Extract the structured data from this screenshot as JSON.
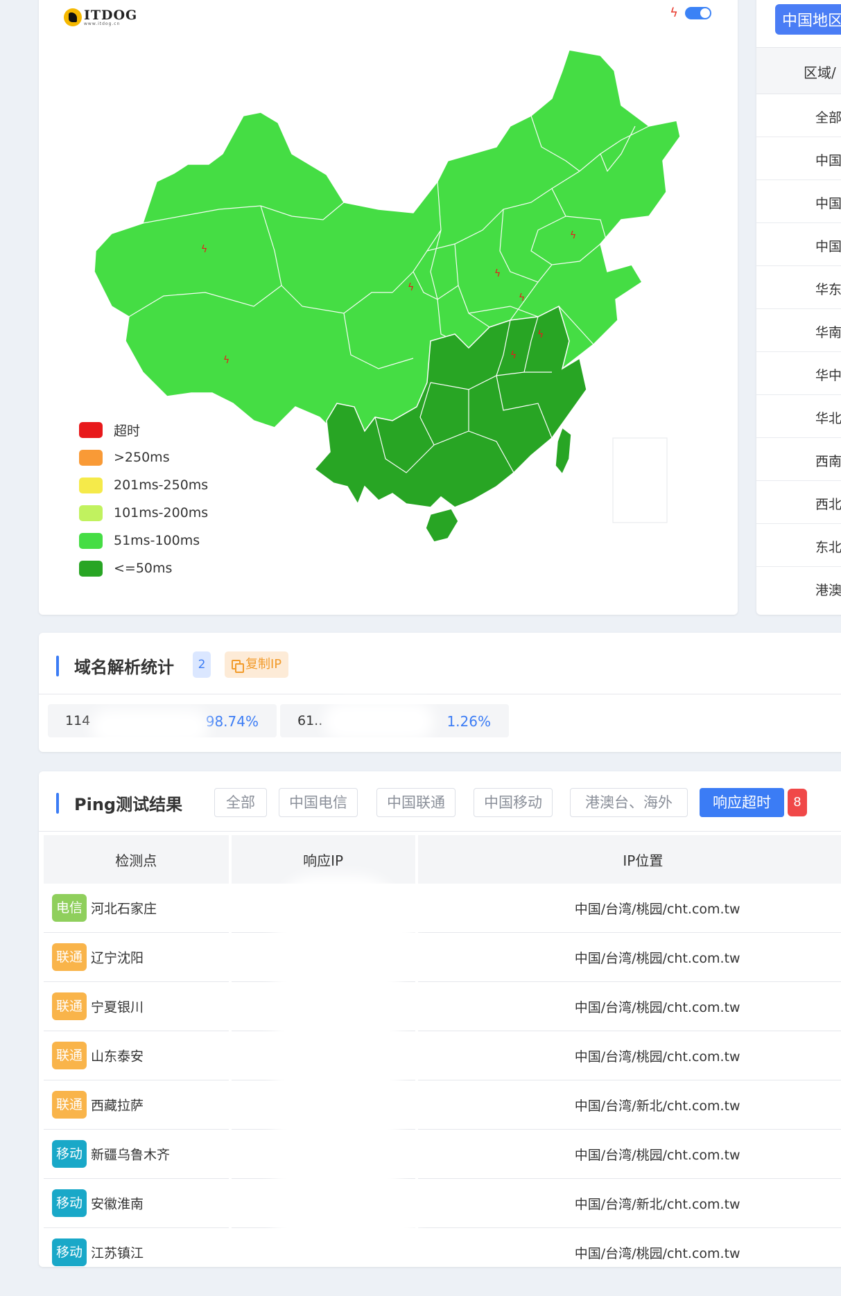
{
  "map": {
    "logo_text": "ITDOG",
    "logo_sub": "www.itdog.cn",
    "legend": [
      {
        "label": "超时",
        "color": "#e8191b"
      },
      {
        "label": ">250ms",
        "color": "#f99a36"
      },
      {
        "label": "201ms-250ms",
        "color": "#f5ea4a"
      },
      {
        "label": "101ms-200ms",
        "color": "#c1f25f"
      },
      {
        "label": "51ms-100ms",
        "color": "#45dd44"
      },
      {
        "label": "<=50ms",
        "color": "#28a524"
      }
    ]
  },
  "region_panel": {
    "button": "中国地区",
    "header": "区域/",
    "rows": [
      "全部",
      "中国",
      "中国",
      "中国",
      "华东",
      "华南",
      "华中",
      "华北",
      "西南",
      "西北",
      "东北",
      "港澳"
    ]
  },
  "dns": {
    "title": "域名解析统计",
    "count": "2",
    "copy_label": "复制IP",
    "ips": [
      {
        "ip": "114",
        "pct": "98.74%"
      },
      {
        "ip": "61..",
        "pct": "1.26%"
      }
    ]
  },
  "ping": {
    "title": "Ping测试结果",
    "tabs": [
      "全部",
      "中国电信",
      "中国联通",
      "中国移动",
      "港澳台、海外",
      "响应超时"
    ],
    "timeout_count": "8",
    "columns": [
      "检测点",
      "响应IP",
      "IP位置"
    ],
    "rows": [
      {
        "isp": "电信",
        "node": "河北石家庄",
        "location": "中国/台湾/桃园/cht.com.tw"
      },
      {
        "isp": "联通",
        "node": "辽宁沈阳",
        "location": "中国/台湾/桃园/cht.com.tw"
      },
      {
        "isp": "联通",
        "node": "宁夏银川",
        "location": "中国/台湾/桃园/cht.com.tw"
      },
      {
        "isp": "联通",
        "node": "山东泰安",
        "location": "中国/台湾/桃园/cht.com.tw"
      },
      {
        "isp": "联通",
        "node": "西藏拉萨",
        "location": "中国/台湾/新北/cht.com.tw"
      },
      {
        "isp": "移动",
        "node": "新疆乌鲁木齐",
        "location": "中国/台湾/桃园/cht.com.tw"
      },
      {
        "isp": "移动",
        "node": "安徽淮南",
        "location": "中国/台湾/新北/cht.com.tw"
      },
      {
        "isp": "移动",
        "node": "江苏镇江",
        "location": "中国/台湾/桃园/cht.com.tw"
      }
    ]
  }
}
